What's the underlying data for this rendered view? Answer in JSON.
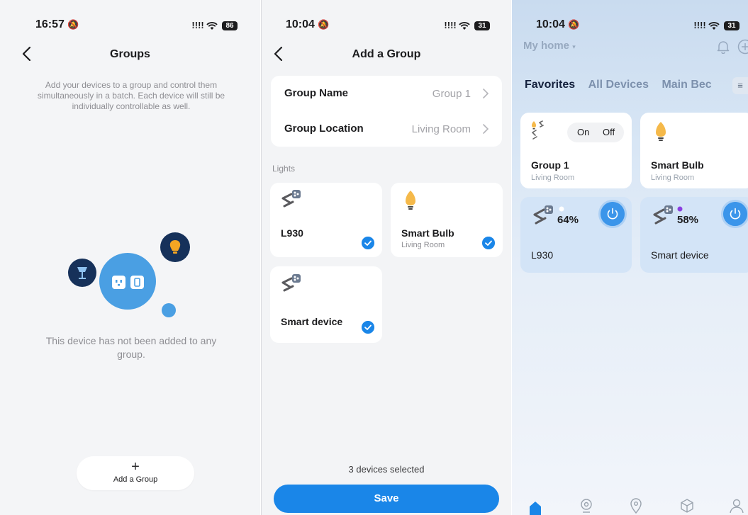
{
  "screen1": {
    "status_time": "16:57",
    "battery": "86",
    "title": "Groups",
    "description": "Add your devices to a group and control them simultaneously in a batch. Each device will still be individually controllable as well.",
    "empty_message": "This device has not been added to any group.",
    "add_group_plus": "+",
    "add_group_label": "Add a Group"
  },
  "screen2": {
    "status_time": "10:04",
    "battery": "31",
    "title": "Add a Group",
    "form": {
      "group_name_label": "Group Name",
      "group_name_value": "Group 1",
      "group_location_label": "Group Location",
      "group_location_value": "Living Room"
    },
    "section_label": "Lights",
    "devices": [
      {
        "name": "L930",
        "room": "",
        "icon": "light-strip-icon",
        "checked": true
      },
      {
        "name": "Smart Bulb",
        "room": "Living Room",
        "icon": "bulb-icon",
        "checked": true
      },
      {
        "name": "Smart device",
        "room": "",
        "icon": "light-strip-icon",
        "checked": true
      }
    ],
    "selected_text": "3 devices selected",
    "save_label": "Save"
  },
  "screen3": {
    "status_time": "10:04",
    "battery": "31",
    "home_title": "My home",
    "tabs": [
      "Favorites",
      "All Devices",
      "Main Bec"
    ],
    "cards": [
      {
        "name": "Group 1",
        "room": "Living Room",
        "on_label": "On",
        "off_label": "Off"
      },
      {
        "name": "Smart Bulb",
        "room": "Living Room"
      },
      {
        "name": "L930",
        "percent": "64%",
        "dot_color": "#ffffff"
      },
      {
        "name": "Smart device",
        "percent": "58%",
        "dot_color": "#8b3fe0"
      }
    ],
    "accent_color": "#1a86e8"
  }
}
